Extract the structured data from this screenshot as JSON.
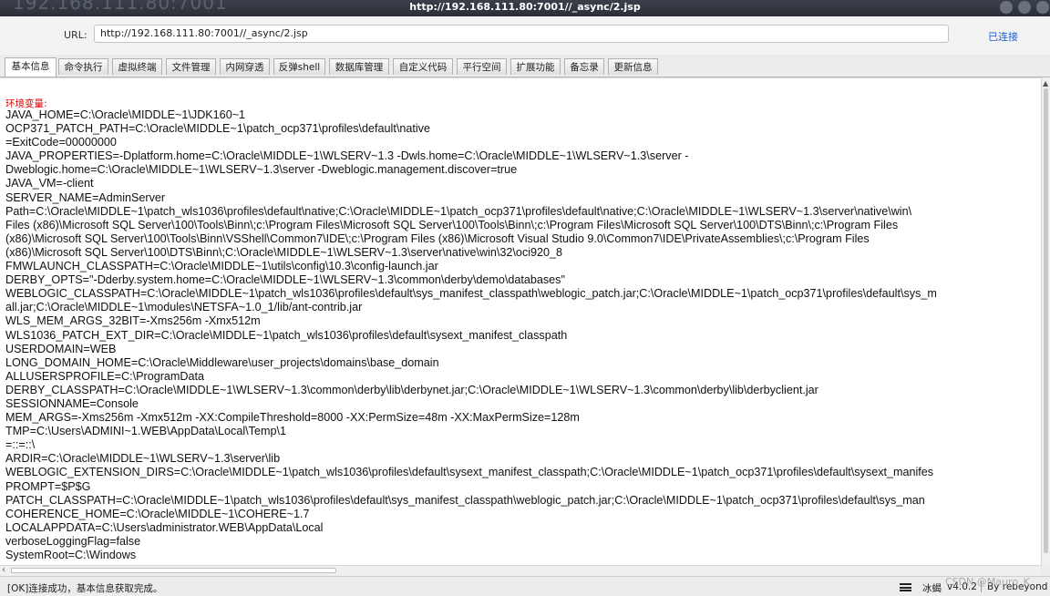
{
  "window": {
    "title": "http://192.168.111.80:7001//_async/2.jsp",
    "ghost_text": "192.168.111.80:7001"
  },
  "url_bar": {
    "label": "URL:",
    "value": "http://192.168.111.80:7001//_async/2.jsp",
    "status": "已连接"
  },
  "tabs": [
    {
      "label": "基本信息",
      "active": true
    },
    {
      "label": "命令执行"
    },
    {
      "label": "虚拟终端"
    },
    {
      "label": "文件管理"
    },
    {
      "label": "内网穿透"
    },
    {
      "label": "反弹shell"
    },
    {
      "label": "数据库管理"
    },
    {
      "label": "自定义代码"
    },
    {
      "label": "平行空间"
    },
    {
      "label": "扩展功能"
    },
    {
      "label": "备忘录"
    },
    {
      "label": "更新信息"
    }
  ],
  "content": {
    "heading": "环境变量:",
    "lines": [
      "JAVA_HOME=C:\\Oracle\\MIDDLE~1\\JDK160~1",
      "OCP371_PATCH_PATH=C:\\Oracle\\MIDDLE~1\\patch_ocp371\\profiles\\default\\native",
      "=ExitCode=00000000",
      "JAVA_PROPERTIES=-Dplatform.home=C:\\Oracle\\MIDDLE~1\\WLSERV~1.3 -Dwls.home=C:\\Oracle\\MIDDLE~1\\WLSERV~1.3\\server -",
      "Dweblogic.home=C:\\Oracle\\MIDDLE~1\\WLSERV~1.3\\server -Dweblogic.management.discover=true",
      "JAVA_VM=-client",
      "SERVER_NAME=AdminServer",
      "Path=C:\\Oracle\\MIDDLE~1\\patch_wls1036\\profiles\\default\\native;C:\\Oracle\\MIDDLE~1\\patch_ocp371\\profiles\\default\\native;C:\\Oracle\\MIDDLE~1\\WLSERV~1.3\\server\\native\\win\\",
      "Files (x86)\\Microsoft SQL Server\\100\\Tools\\Binn\\;c:\\Program Files\\Microsoft SQL Server\\100\\Tools\\Binn\\;c:\\Program Files\\Microsoft SQL Server\\100\\DTS\\Binn\\;c:\\Program Files",
      "(x86)\\Microsoft SQL Server\\100\\Tools\\Binn\\VSShell\\Common7\\IDE\\;c:\\Program Files (x86)\\Microsoft Visual Studio 9.0\\Common7\\IDE\\PrivateAssemblies\\;c:\\Program Files",
      "(x86)\\Microsoft SQL Server\\100\\DTS\\Binn\\;C:\\Oracle\\MIDDLE~1\\WLSERV~1.3\\server\\native\\win\\32\\oci920_8",
      "FMWLAUNCH_CLASSPATH=C:\\Oracle\\MIDDLE~1\\utils\\config\\10.3\\config-launch.jar",
      "DERBY_OPTS=\"-Dderby.system.home=C:\\Oracle\\MIDDLE~1\\WLSERV~1.3\\common\\derby\\demo\\databases\"",
      "WEBLOGIC_CLASSPATH=C:\\Oracle\\MIDDLE~1\\patch_wls1036\\profiles\\default\\sys_manifest_classpath\\weblogic_patch.jar;C:\\Oracle\\MIDDLE~1\\patch_ocp371\\profiles\\default\\sys_m",
      "all.jar;C:\\Oracle\\MIDDLE~1\\modules\\NETSFA~1.0_1/lib/ant-contrib.jar",
      "WLS_MEM_ARGS_32BIT=-Xms256m -Xmx512m",
      "WLS1036_PATCH_EXT_DIR=C:\\Oracle\\MIDDLE~1\\patch_wls1036\\profiles\\default\\sysext_manifest_classpath",
      "USERDOMAIN=WEB",
      "LONG_DOMAIN_HOME=C:\\Oracle\\Middleware\\user_projects\\domains\\base_domain",
      "ALLUSERSPROFILE=C:\\ProgramData",
      "DERBY_CLASSPATH=C:\\Oracle\\MIDDLE~1\\WLSERV~1.3\\common\\derby\\lib\\derbynet.jar;C:\\Oracle\\MIDDLE~1\\WLSERV~1.3\\common\\derby\\lib\\derbyclient.jar",
      "SESSIONNAME=Console",
      "MEM_ARGS=-Xms256m -Xmx512m -XX:CompileThreshold=8000 -XX:PermSize=48m -XX:MaxPermSize=128m",
      "TMP=C:\\Users\\ADMINI~1.WEB\\AppData\\Local\\Temp\\1",
      "=::=::\\",
      "ARDIR=C:\\Oracle\\MIDDLE~1\\WLSERV~1.3\\server\\lib",
      "WEBLOGIC_EXTENSION_DIRS=C:\\Oracle\\MIDDLE~1\\patch_wls1036\\profiles\\default\\sysext_manifest_classpath;C:\\Oracle\\MIDDLE~1\\patch_ocp371\\profiles\\default\\sysext_manifes",
      "PROMPT=$P$G",
      "PATCH_CLASSPATH=C:\\Oracle\\MIDDLE~1\\patch_wls1036\\profiles\\default\\sys_manifest_classpath\\weblogic_patch.jar;C:\\Oracle\\MIDDLE~1\\patch_ocp371\\profiles\\default\\sys_man",
      "COHERENCE_HOME=C:\\Oracle\\MIDDLE~1\\COHERE~1.7",
      "LOCALAPPDATA=C:\\Users\\administrator.WEB\\AppData\\Local",
      "verboseLoggingFlag=false",
      "SystemRoot=C:\\Windows"
    ]
  },
  "status_bar": {
    "message": "[OK]连接成功，基本信息获取完成。",
    "app_name": "冰蝎",
    "version": "v4.0.2",
    "author": "By rebeyond",
    "watermark": "CSDN @Mauro_K"
  },
  "icons": {
    "menu": "menu-icon",
    "scroll_up": "scroll-up-arrow-icon",
    "scroll_left": "scroll-left-arrow-icon"
  }
}
